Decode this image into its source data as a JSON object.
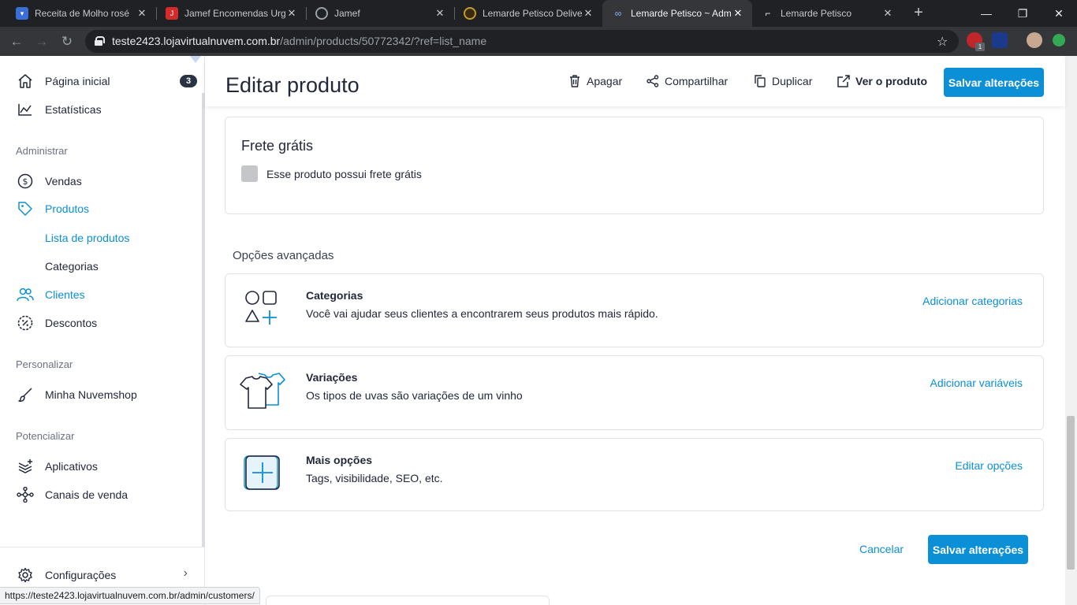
{
  "browser": {
    "tabs": [
      {
        "title": "Receita de Molho rosé",
        "active": false
      },
      {
        "title": "Jamef Encomendas Urg",
        "active": false
      },
      {
        "title": "Jamef",
        "active": false
      },
      {
        "title": "Lemarde Petisco Delive",
        "active": false
      },
      {
        "title": "Lemarde Petisco ~ Adm",
        "active": true
      },
      {
        "title": "Lemarde Petisco",
        "active": false
      }
    ],
    "url_host": "teste2423.lojavirtualnuvem.com.br",
    "url_path": "/admin/products/50772342/?ref=list_name",
    "extension_badge": "1",
    "status_url": "https://teste2423.lojavirtualnuvem.com.br/admin/customers/"
  },
  "sidebar": {
    "home_label": "Página inicial",
    "home_badge": "3",
    "stats_label": "Estatísticas",
    "section_admin": "Administrar",
    "sales_label": "Vendas",
    "products_label": "Produtos",
    "product_list_label": "Lista de produtos",
    "categories_label": "Categorias",
    "customers_label": "Clientes",
    "discounts_label": "Descontos",
    "section_customize": "Personalizar",
    "mystore_label": "Minha Nuvemshop",
    "section_boost": "Potencializar",
    "apps_label": "Aplicativos",
    "channels_label": "Canais de venda",
    "settings_label": "Configurações"
  },
  "header": {
    "title": "Editar produto",
    "delete_label": "Apagar",
    "share_label": "Compartilhar",
    "duplicate_label": "Duplicar",
    "view_label": "Ver o produto",
    "save_label": "Salvar alterações"
  },
  "shipping": {
    "title": "Frete grátis",
    "checkbox_label": "Esse produto possui frete grátis",
    "checked": false
  },
  "advanced": {
    "title": "Opções avançadas",
    "options": [
      {
        "title": "Categorias",
        "description": "Você vai ajudar seus clientes a encontrarem seus produtos mais rápido.",
        "action": "Adicionar categorias",
        "icon": "shapes-icon"
      },
      {
        "title": "Variações",
        "description": "Os tipos de uvas são variações de um vinho",
        "action": "Adicionar variáveis",
        "icon": "tshirt-icon"
      },
      {
        "title": "Mais opções",
        "description": "Tags, visibilidade, SEO, etc.",
        "action": "Editar opções",
        "icon": "plus-square-icon"
      }
    ]
  },
  "footer": {
    "cancel_label": "Cancelar",
    "save_label": "Salvar alterações"
  },
  "colors": {
    "accent": "#0b8fd6",
    "text": "#22283a",
    "chrome_dark": "#202124"
  }
}
